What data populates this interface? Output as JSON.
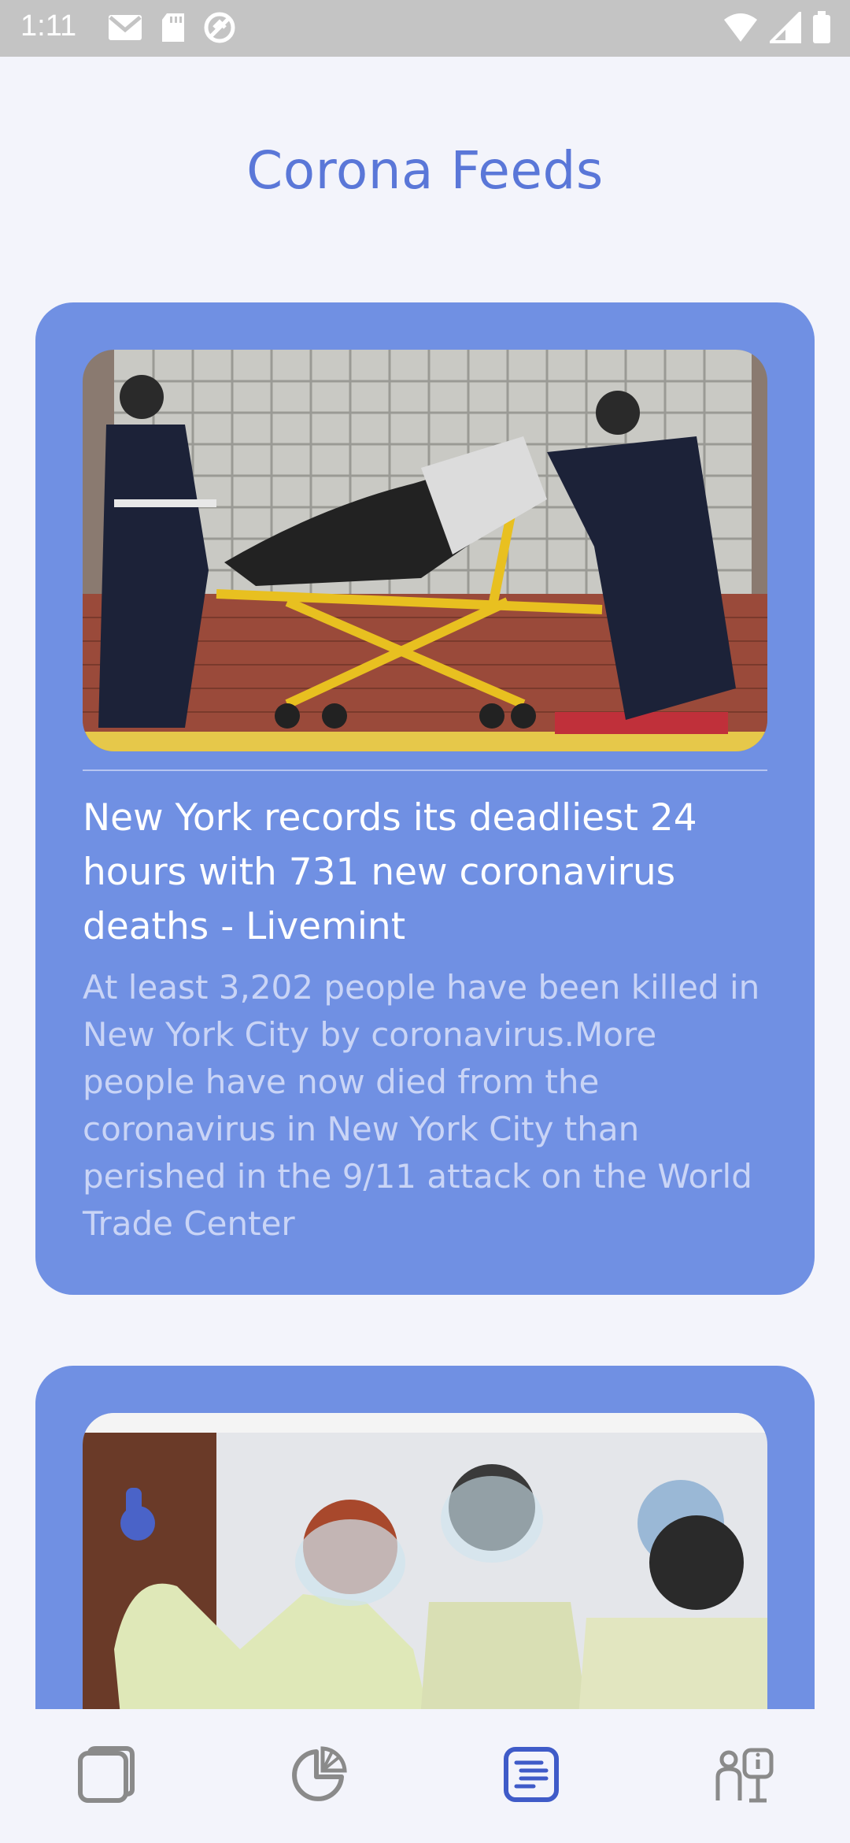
{
  "status_bar": {
    "time": "1:11",
    "left_icons": [
      "gmail-icon",
      "sd-card-icon",
      "sync-icon"
    ],
    "right_icons": [
      "wifi-icon",
      "signal-icon",
      "battery-icon"
    ]
  },
  "header": {
    "title": "Corona Feeds"
  },
  "feed": {
    "articles": [
      {
        "image": "ambulance-stretcher-photo",
        "headline": "New York records its deadliest 24 hours with 731 new coronavirus deaths - Livemint",
        "summary": "At least 3,202 people have been killed in New York City by coronavirus.More people have now died from the coronavirus in New York City than perished in the 9/11 attack on the World Trade Center"
      },
      {
        "image": "health-workers-photo"
      }
    ]
  },
  "bottom_nav": {
    "items": [
      {
        "icon": "cards-icon",
        "active": false
      },
      {
        "icon": "pie-chart-icon",
        "active": false
      },
      {
        "icon": "feed-list-icon",
        "active": true
      },
      {
        "icon": "person-info-icon",
        "active": false
      }
    ]
  },
  "colors": {
    "accent": "#5a77d8",
    "card": "#7090e3",
    "background": "#f3f4fb",
    "inactive_icon": "#8a8a8a"
  }
}
